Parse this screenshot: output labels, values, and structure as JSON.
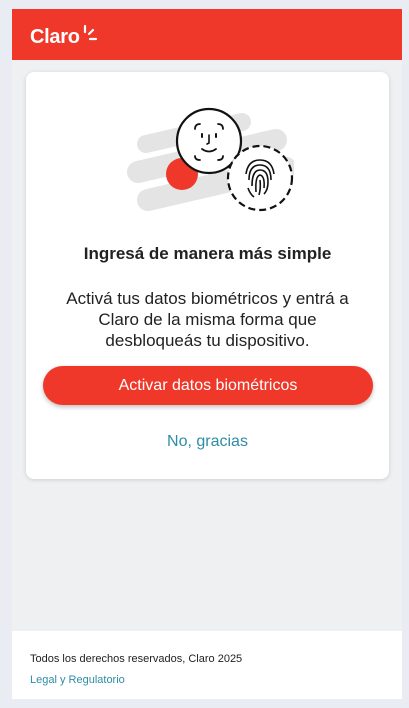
{
  "header": {
    "brand": "Claro",
    "brand_color": "#ef3829"
  },
  "card": {
    "illustration_icons": [
      "face-icon",
      "fingerprint-icon"
    ],
    "title": "Ingresá de manera más simple",
    "description": "Activá tus datos biométricos y entrá a Claro de la misma forma que desbloqueás tu dispositivo.",
    "primary_button": "Activar datos biométricos",
    "secondary_link": "No, gracias"
  },
  "footer": {
    "copyright": "Todos los derechos reservados, Claro 2025",
    "legal_link": "Legal y Regulatorio"
  },
  "colors": {
    "accent": "#ef3829",
    "link": "#2e8da5",
    "background": "#eff0f1"
  }
}
